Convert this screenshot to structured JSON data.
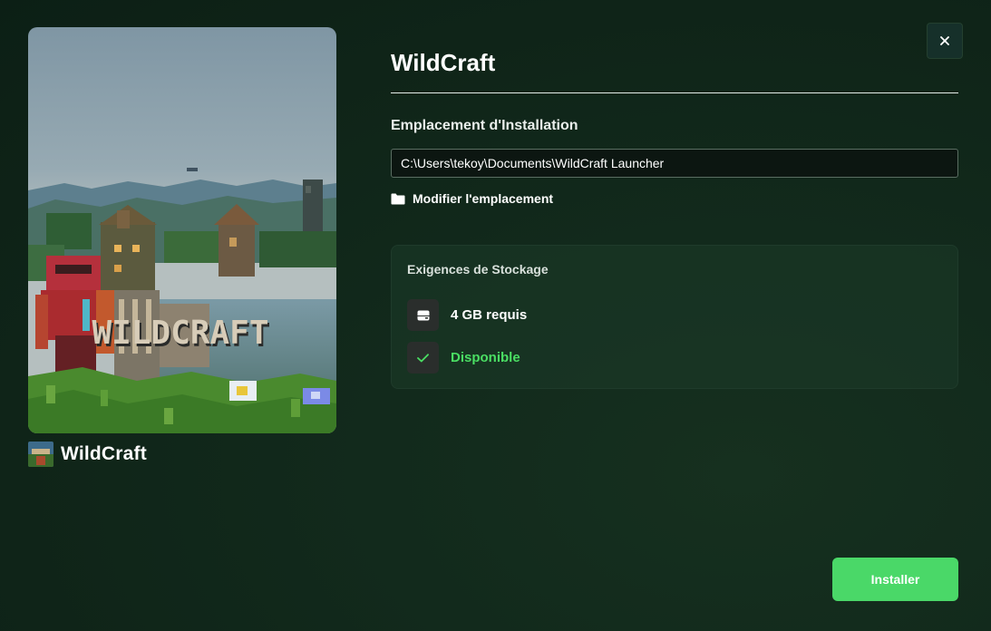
{
  "game": {
    "name": "WildCraft",
    "cover_logo_text": "WILDCRAFT"
  },
  "dialog": {
    "title": "WildCraft",
    "close_label": "×"
  },
  "install_location": {
    "section_label": "Emplacement d'Installation",
    "path_value": "C:\\Users\\tekoy\\Documents\\WildCraft Launcher",
    "change_label": "Modifier l'emplacement",
    "change_icon": "folder-icon"
  },
  "storage": {
    "title": "Exigences de Stockage",
    "required_label": "4 GB requis",
    "required_icon": "hard-drive-icon",
    "status_label": "Disponible",
    "status_icon": "check-icon"
  },
  "actions": {
    "install_label": "Installer"
  },
  "colors": {
    "accent_green": "#4ad868",
    "status_green": "#4ade63",
    "background": "#122a1c"
  }
}
